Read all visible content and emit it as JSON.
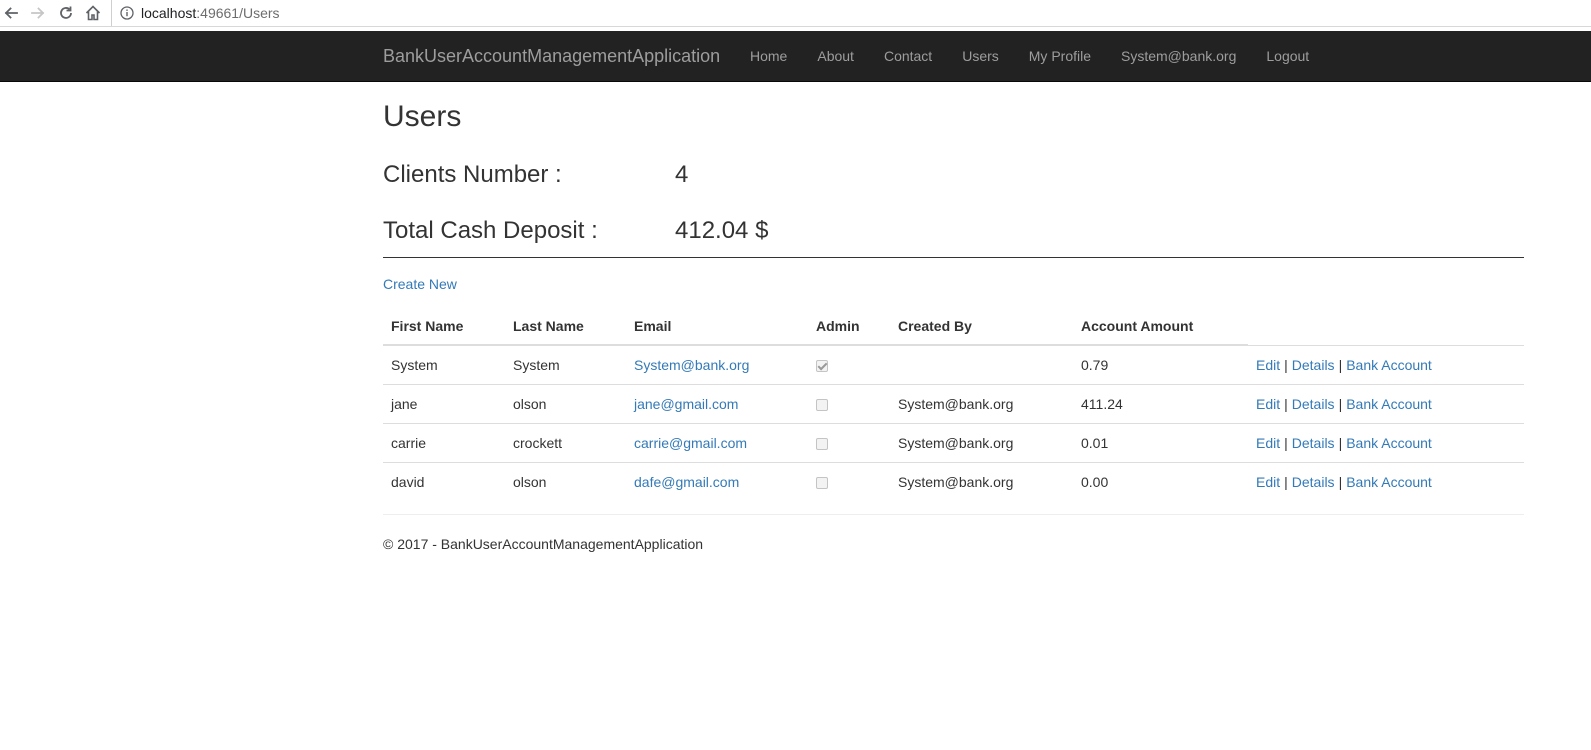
{
  "browser": {
    "url_host": "localhost",
    "url_rest": ":49661/Users",
    "icons": [
      "back-arrow-icon",
      "forward-arrow-icon",
      "reload-icon",
      "home-icon",
      "info-icon"
    ]
  },
  "navbar": {
    "brand": "BankUserAccountManagementApplication",
    "links": {
      "home": "Home",
      "about": "About",
      "contact": "Contact",
      "users": "Users",
      "profile": "My Profile",
      "account": "System@bank.org",
      "logout": "Logout"
    }
  },
  "page": {
    "title": "Users",
    "clients_label": "Clients Number :",
    "clients_value": "4",
    "cash_label": "Total Cash Deposit :",
    "cash_value": "412.04 $",
    "create_link": "Create New"
  },
  "table": {
    "headers": {
      "first_name": "First Name",
      "last_name": "Last Name",
      "email": "Email",
      "admin": "Admin",
      "created_by": "Created By",
      "account_amount": "Account Amount"
    },
    "action_labels": {
      "edit": "Edit",
      "details": "Details",
      "bank_account": "Bank Account",
      "separator": "|"
    },
    "rows": [
      {
        "first_name": "System",
        "last_name": "System",
        "email": "System@bank.org",
        "admin": true,
        "created_by": "",
        "account_amount": "0.79"
      },
      {
        "first_name": "jane",
        "last_name": "olson",
        "email": "jane@gmail.com",
        "admin": false,
        "created_by": "System@bank.org",
        "account_amount": "411.24"
      },
      {
        "first_name": "carrie",
        "last_name": "crockett",
        "email": "carrie@gmail.com",
        "admin": false,
        "created_by": "System@bank.org",
        "account_amount": "0.01"
      },
      {
        "first_name": "david",
        "last_name": "olson",
        "email": "dafe@gmail.com",
        "admin": false,
        "created_by": "System@bank.org",
        "account_amount": "0.00"
      }
    ]
  },
  "footer": {
    "text": "© 2017 - BankUserAccountManagementApplication"
  },
  "colors": {
    "navbar_bg": "#222222",
    "nav_text": "#9d9d9d",
    "link": "#337ab7",
    "text": "#333333"
  }
}
